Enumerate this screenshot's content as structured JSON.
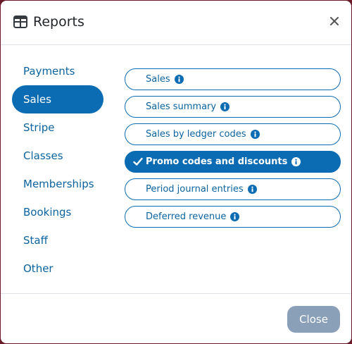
{
  "modal": {
    "title": "Reports",
    "title_icon": "table-icon",
    "close_icon": "close-icon"
  },
  "nav": {
    "items": [
      {
        "label": "Payments",
        "active": false
      },
      {
        "label": "Sales",
        "active": true
      },
      {
        "label": "Stripe",
        "active": false
      },
      {
        "label": "Classes",
        "active": false
      },
      {
        "label": "Memberships",
        "active": false
      },
      {
        "label": "Bookings",
        "active": false
      },
      {
        "label": "Staff",
        "active": false
      },
      {
        "label": "Other",
        "active": false
      }
    ]
  },
  "reports": {
    "items": [
      {
        "label": "Sales",
        "selected": false
      },
      {
        "label": "Sales summary",
        "selected": false
      },
      {
        "label": "Sales by ledger codes",
        "selected": false
      },
      {
        "label": "Promo codes and discounts",
        "selected": true
      },
      {
        "label": "Period journal entries",
        "selected": false
      },
      {
        "label": "Deferred revenue",
        "selected": false
      }
    ],
    "info_icon": "info-icon",
    "check_icon": "check-icon"
  },
  "footer": {
    "close_label": "Close"
  },
  "colors": {
    "accent": "#0b6cb3",
    "close_button": "#8a9fb8",
    "backdrop": "#6b1a2a"
  }
}
